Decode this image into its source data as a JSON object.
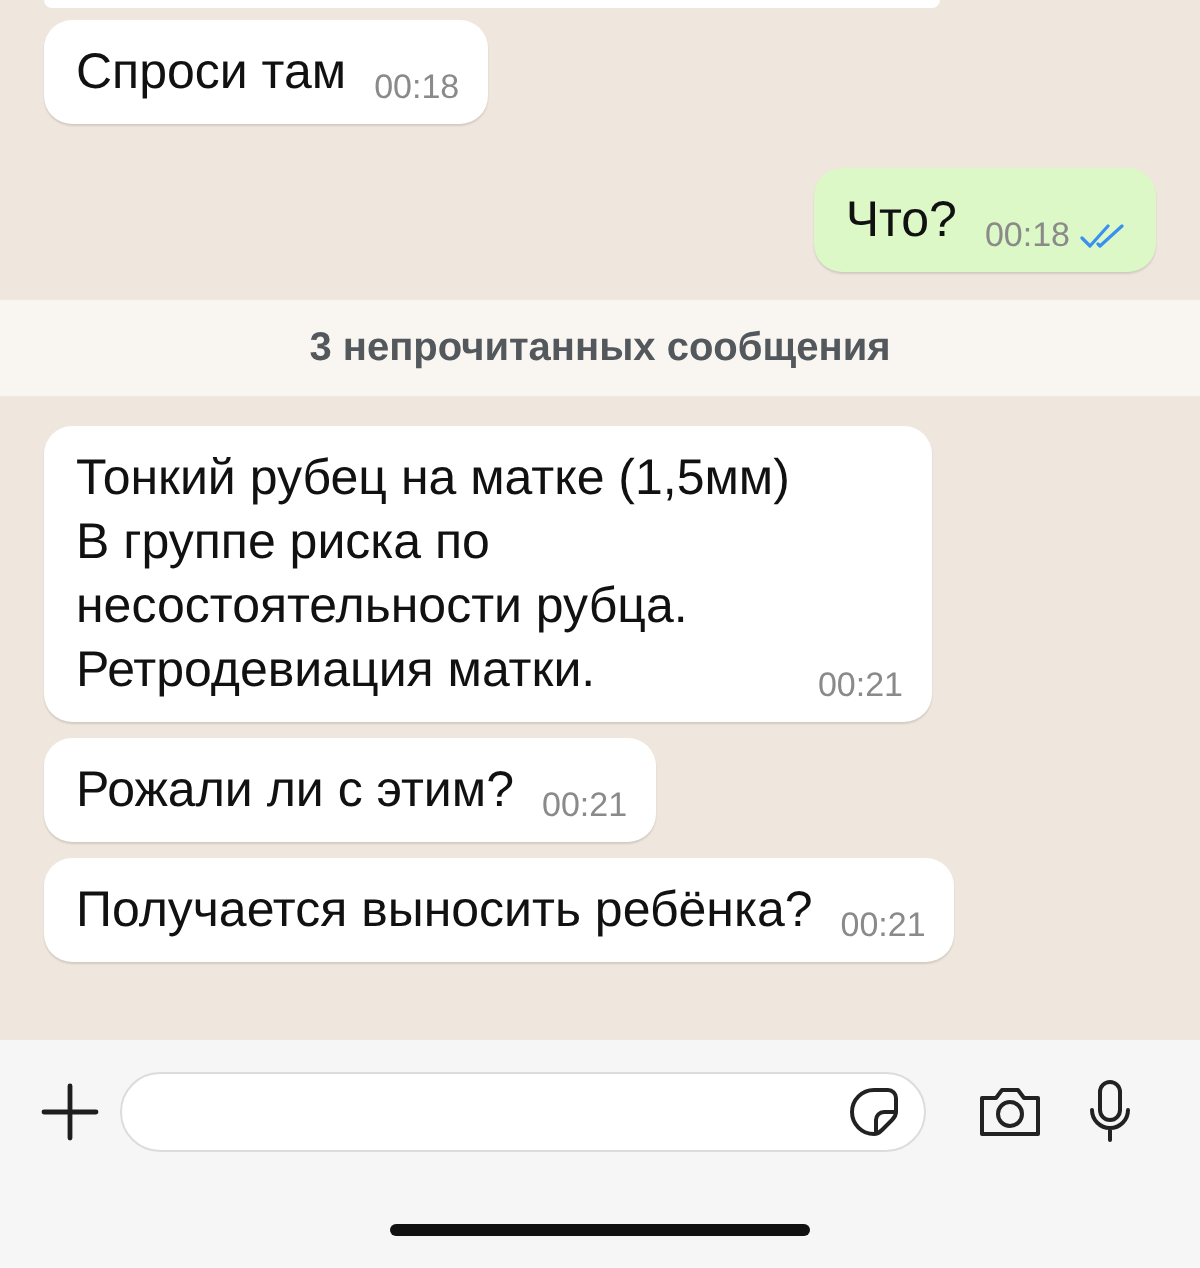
{
  "messages": [
    {
      "kind": "incoming",
      "text": "Спроси там",
      "time": "00:18"
    },
    {
      "kind": "outgoing",
      "text": "Что?",
      "time": "00:18",
      "read": true
    },
    {
      "kind": "banner",
      "text": "3 непрочитанных сообщения"
    },
    {
      "kind": "incoming",
      "text": "Тонкий рубец на матке (1,5мм)\nВ группе риска по\nнесостоятельности рубца.\nРетродевиация матки.",
      "time": "00:21"
    },
    {
      "kind": "incoming",
      "text": "Рожали ли с этим?",
      "time": "00:21"
    },
    {
      "kind": "incoming",
      "text": "Получается выносить ребёнка?",
      "time": "00:21"
    }
  ]
}
